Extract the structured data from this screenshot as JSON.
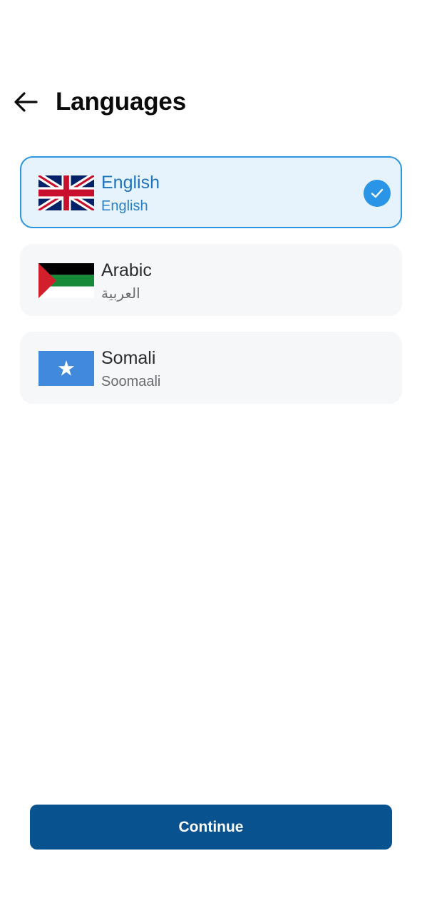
{
  "header": {
    "title": "Languages",
    "back_icon": "arrow-left-icon"
  },
  "languages": [
    {
      "name": "English",
      "native": "English",
      "flag_icon": "uk-flag-icon",
      "selected": true
    },
    {
      "name": "Arabic",
      "native": "العربية",
      "flag_icon": "arabic-flag-icon",
      "selected": false
    },
    {
      "name": "Somali",
      "native": "Soomaali",
      "flag_icon": "somalia-flag-icon",
      "selected": false
    }
  ],
  "selected_check_icon": "checkmark-icon",
  "footer": {
    "continue_label": "Continue"
  },
  "colors": {
    "accent": "#2a95e6",
    "selected_bg": "#e6f3fc",
    "primary_button": "#08528f"
  }
}
